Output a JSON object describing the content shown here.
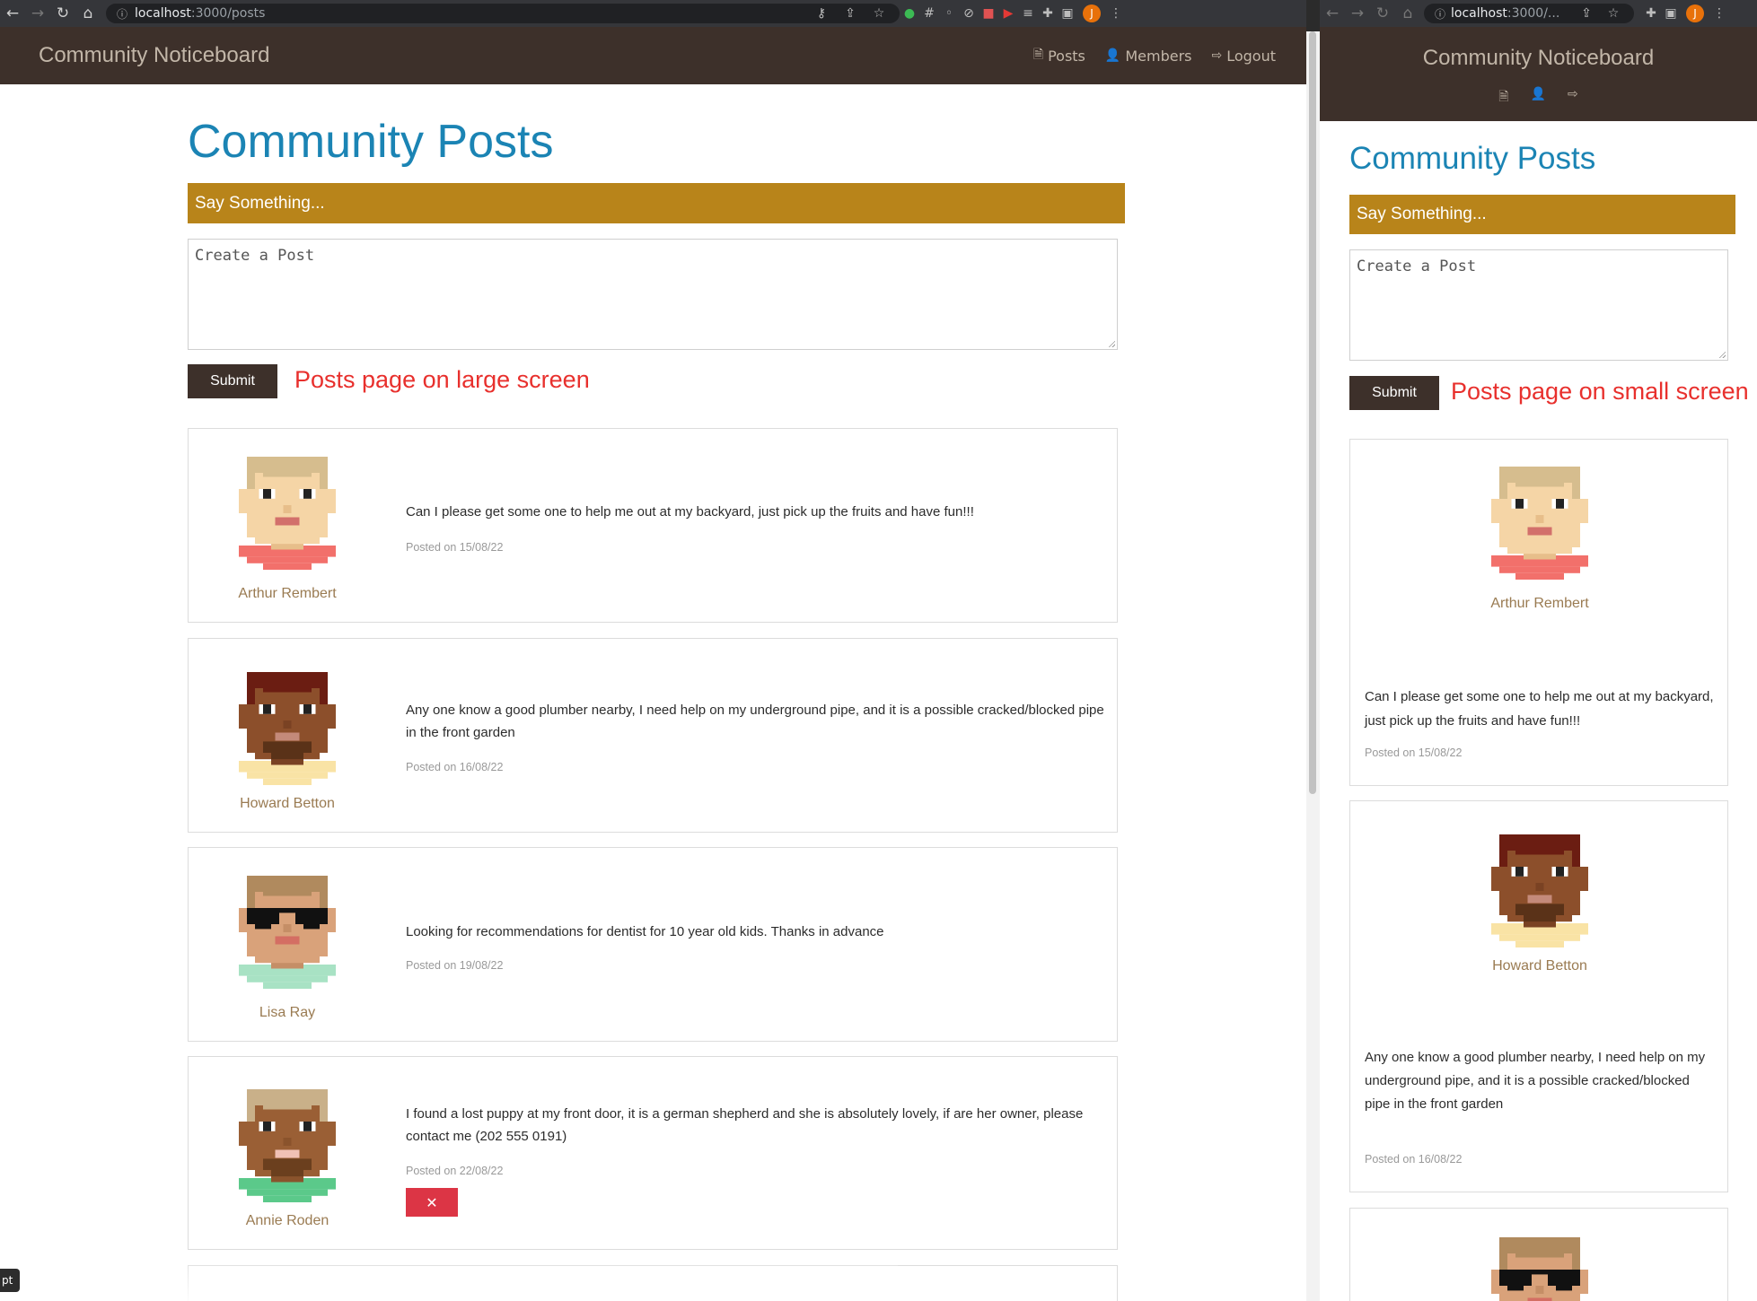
{
  "browser_large": {
    "url_host": "localhost",
    "url_path": ":3000/posts",
    "profile_initial": "J"
  },
  "browser_small": {
    "url_host": "localhost",
    "url_path": ":3000/...",
    "profile_initial": "J"
  },
  "app": {
    "brand": "Community Noticeboard",
    "nav": {
      "posts": "Posts",
      "members": "Members",
      "logout": "Logout"
    }
  },
  "page": {
    "title": "Community Posts",
    "say_something": "Say Something...",
    "textarea_placeholder": "Create a Post",
    "submit_label": "Submit"
  },
  "annotations": {
    "large": "Posts page on large screen",
    "small": "Posts page on small screen"
  },
  "posts": [
    {
      "author": "Arthur Rembert",
      "text": "Can I please get some one to help me out at my backyard, just pick up the fruits and have fun!!!",
      "posted": "Posted on 15/08/22",
      "avatar": "avatar-arthur"
    },
    {
      "author": "Howard Betton",
      "text": "Any one know a good plumber nearby, I need help on my underground pipe, and it is a possible cracked/blocked pipe in the front garden",
      "posted": "Posted on 16/08/22",
      "avatar": "avatar-howard"
    },
    {
      "author": "Lisa Ray",
      "text": "Looking for recommendations for dentist for 10 year old kids. Thanks in advance",
      "posted": "Posted on 19/08/22",
      "avatar": "avatar-lisa"
    },
    {
      "author": "Annie Roden",
      "text": "I found a lost puppy at my front door, it is a german shepherd and she is absolutely lovely, if are her owner, please contact me (202 555 0191)",
      "posted": "Posted on 22/08/22",
      "avatar": "avatar-annie",
      "delete_label": "✕"
    }
  ],
  "tooltip": "pt",
  "colors": {
    "navbar": "#3d302a",
    "title": "#1b84b4",
    "say_bar": "#b8841a",
    "annotation": "#e8302d",
    "author": "#9a7b52",
    "delete": "#dc3545"
  }
}
